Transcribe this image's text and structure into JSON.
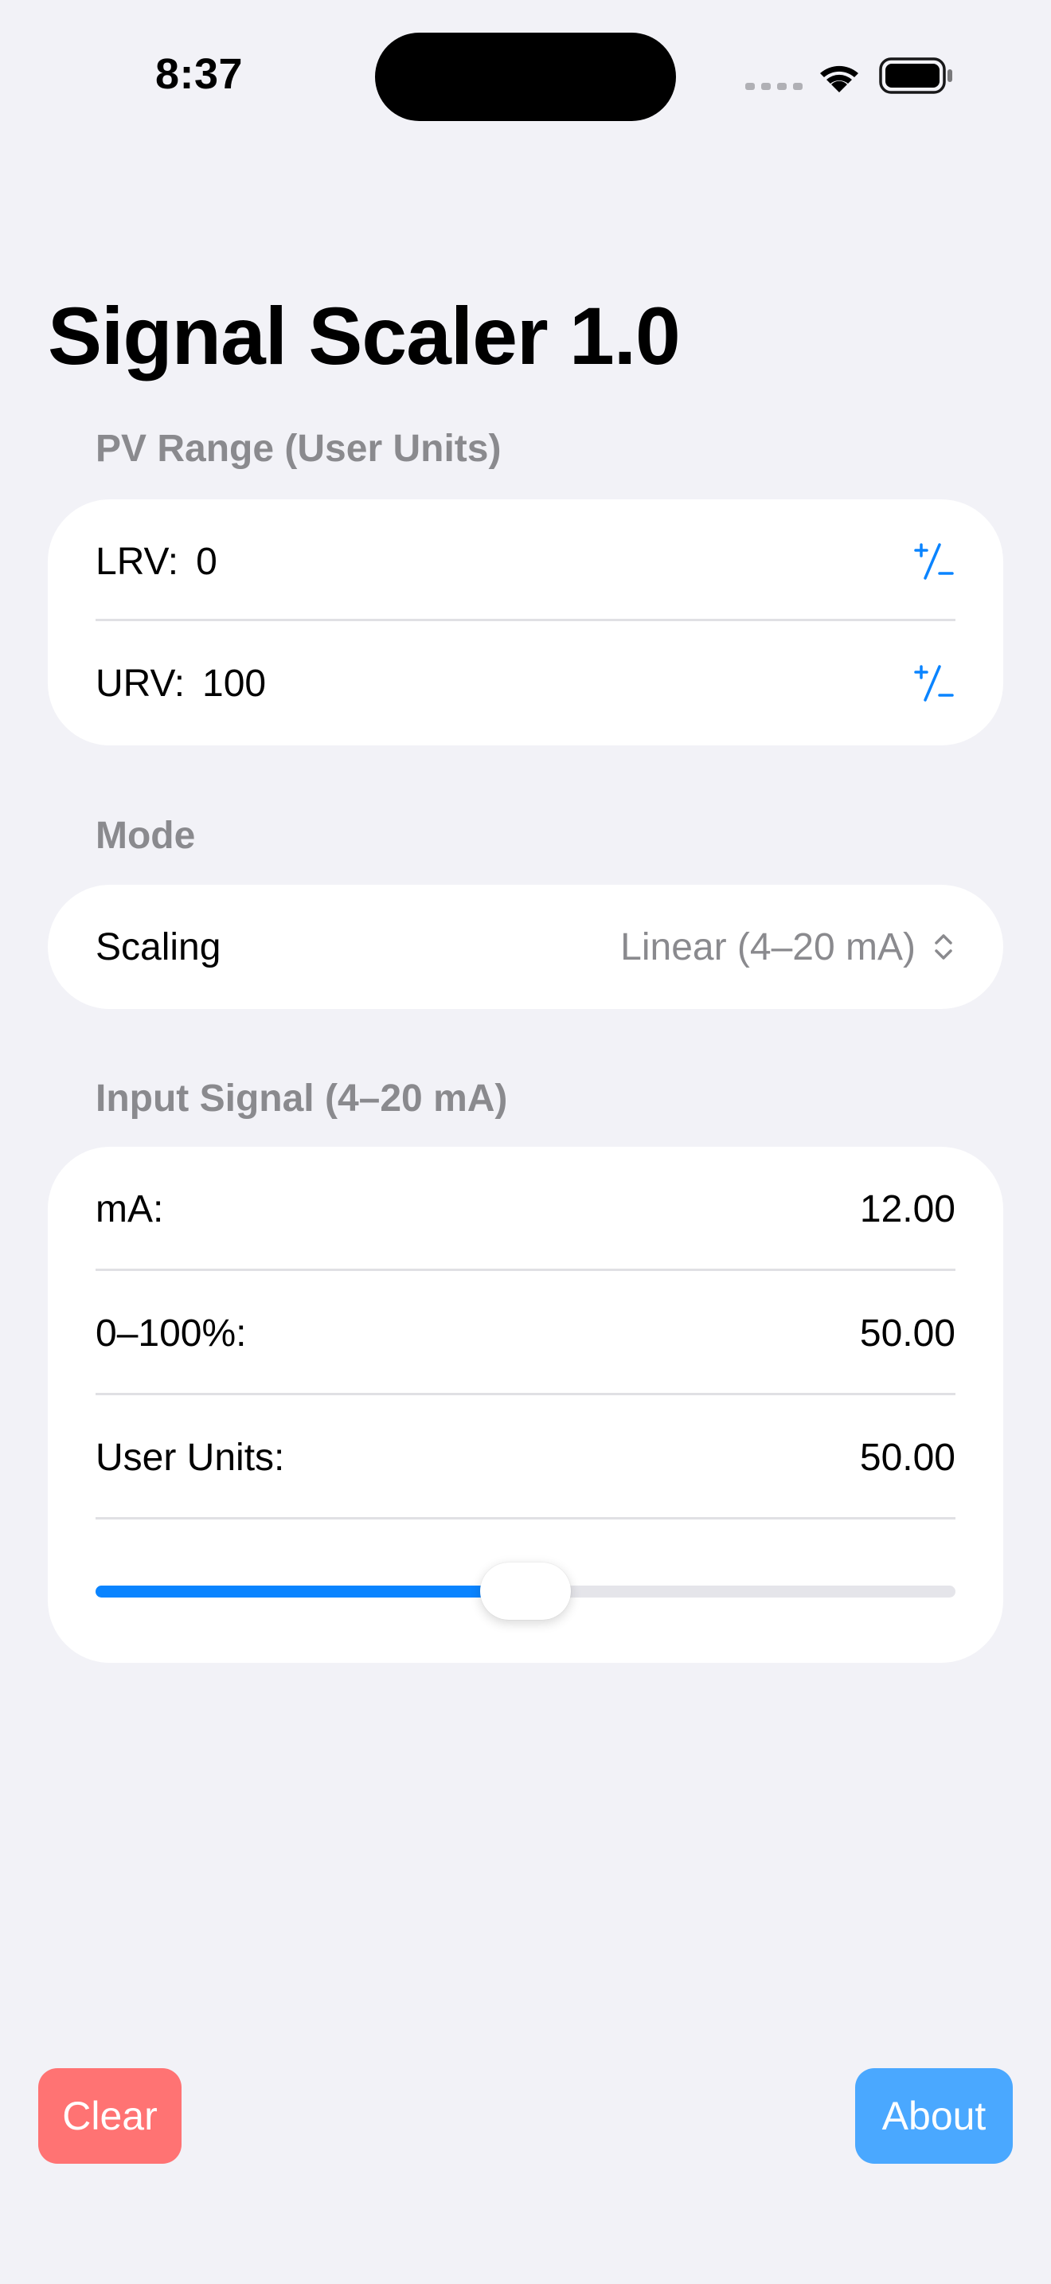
{
  "status_bar": {
    "time": "8:37"
  },
  "title": "Signal Scaler 1.0",
  "pv_range": {
    "header": "PV Range (User Units)",
    "lrv_label": "LRV:",
    "lrv_value": "0",
    "urv_label": "URV:",
    "urv_value": "100",
    "sign_toggle_icon": "plus-minus-icon"
  },
  "mode": {
    "header": "Mode",
    "scaling_label": "Scaling",
    "scaling_value": "Linear (4–20 mA)"
  },
  "input_signal": {
    "header": "Input Signal (4–20 mA)",
    "ma_label": "mA:",
    "ma_value": "12.00",
    "percent_label": "0–100%:",
    "percent_value": "50.00",
    "user_units_label": "User Units:",
    "user_units_value": "50.00",
    "slider_fraction": 0.5
  },
  "buttons": {
    "clear": "Clear",
    "about": "About"
  },
  "colors": {
    "accent": "#0A84FF",
    "clear_button": "#FF7373",
    "about_button": "#4AA8FF",
    "background": "#F2F2F7",
    "secondary_text": "#8A8A8E"
  }
}
